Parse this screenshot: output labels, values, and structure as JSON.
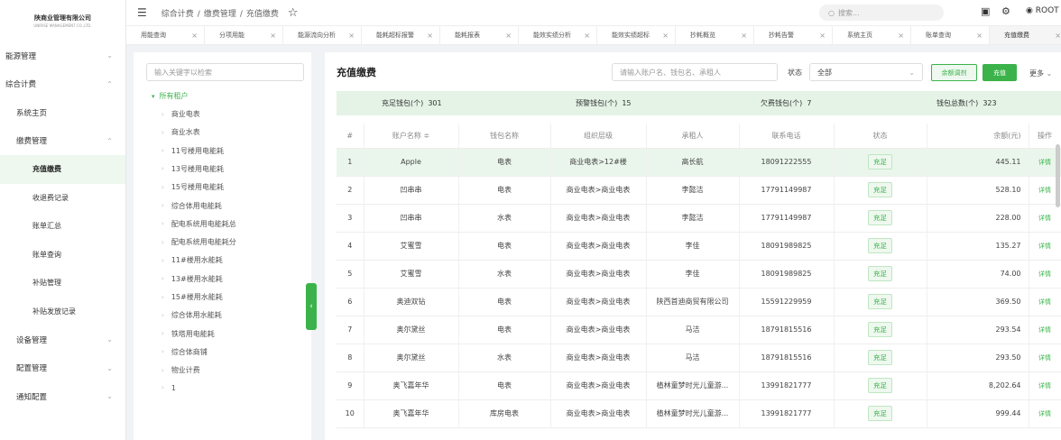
{
  "logo": {
    "name": "陕商业管理有限公司",
    "sub": "UNIRISE MANAGEMENT CO.,LTD."
  },
  "sidebar": {
    "items": [
      {
        "label": "能源管理",
        "level": 0,
        "chevron": "⌄"
      },
      {
        "label": "综合计费",
        "level": 0,
        "chevron": "⌃"
      },
      {
        "label": "系统主页",
        "level": 1,
        "chevron": ""
      },
      {
        "label": "缴费管理",
        "level": 1,
        "chevron": "⌃"
      },
      {
        "label": "充值缴费",
        "level": 2,
        "chevron": ""
      },
      {
        "label": "收退费记录",
        "level": 2,
        "chevron": ""
      },
      {
        "label": "账单汇总",
        "level": 2,
        "chevron": ""
      },
      {
        "label": "账单查询",
        "level": 2,
        "chevron": ""
      },
      {
        "label": "补贴管理",
        "level": 2,
        "chevron": ""
      },
      {
        "label": "补贴发放记录",
        "level": 2,
        "chevron": ""
      },
      {
        "label": "设备管理",
        "level": 1,
        "chevron": "⌄"
      },
      {
        "label": "配置管理",
        "level": 1,
        "chevron": "⌄"
      },
      {
        "label": "通知配置",
        "level": 1,
        "chevron": "⌄"
      }
    ]
  },
  "header": {
    "breadcrumb": [
      "综合计费",
      "缴费管理",
      "充值缴费"
    ],
    "search_placeholder": "搜索...",
    "user": "ROOT"
  },
  "tabs": [
    "用能查询",
    "分项用能",
    "能源流向分析",
    "能耗超标报警",
    "能耗报表",
    "能效实绩分析",
    "能效实绩超标",
    "抄耗概览",
    "抄耗告警",
    "系统主页",
    "账单查询",
    "充值缴费"
  ],
  "tree": {
    "search_placeholder": "输入关键字以检索",
    "root": "所有租户",
    "children": [
      "商业电表",
      "商业水表",
      "11号楼用电能耗",
      "13号楼用电能耗",
      "15号楼用电能耗",
      "综合体用电能耗",
      "配电系统用电能耗总",
      "配电系统用电能耗分",
      "11#楼用水能耗",
      "13#楼用水能耗",
      "15#楼用水能耗",
      "综合体用水能耗",
      "铁塔用电能耗",
      "综合体商铺",
      "物业计费",
      "1"
    ]
  },
  "main": {
    "title": "充值缴费",
    "acct_placeholder": "请输入账户名、钱包名、承租人",
    "status_label": "状态",
    "status_value": "全部",
    "btn_adjust": "余额调剂",
    "btn_charge": "充值",
    "more": "更多"
  },
  "summary": [
    {
      "label": "充足钱包(个)",
      "value": "301"
    },
    {
      "label": "预警钱包(个)",
      "value": "15"
    },
    {
      "label": "欠费钱包(个)",
      "value": "7"
    },
    {
      "label": "钱包总数(个)",
      "value": "323"
    }
  ],
  "table": {
    "headers": [
      "#",
      "账户名称 ≑",
      "钱包名称",
      "组织层级",
      "承租人",
      "联系电话",
      "状态",
      "余额(元)",
      "操作"
    ],
    "rows": [
      [
        "1",
        "Apple",
        "电表",
        "商业电表>12#楼",
        "高长航",
        "18091222555",
        "充足",
        "445.11",
        "详情"
      ],
      [
        "2",
        "凹串串",
        "电表",
        "商业电表>商业电表",
        "李懿洁",
        "17791149987",
        "充足",
        "528.10",
        "详情"
      ],
      [
        "3",
        "凹串串",
        "水表",
        "商业电表>商业电表",
        "李懿洁",
        "17791149987",
        "充足",
        "228.00",
        "详情"
      ],
      [
        "4",
        "艾蜜雪",
        "电表",
        "商业电表>商业电表",
        "李佳",
        "18091989825",
        "充足",
        "135.27",
        "详情"
      ],
      [
        "5",
        "艾蜜雪",
        "水表",
        "商业电表>商业电表",
        "李佳",
        "18091989825",
        "充足",
        "74.00",
        "详情"
      ],
      [
        "6",
        "奥迪双钻",
        "电表",
        "商业电表>商业电表",
        "陕西首迪商贸有限公司",
        "15591229959",
        "充足",
        "369.50",
        "详情"
      ],
      [
        "7",
        "奥尔黛丝",
        "电表",
        "商业电表>商业电表",
        "马洁",
        "18791815516",
        "充足",
        "293.54",
        "详情"
      ],
      [
        "8",
        "奥尔黛丝",
        "水表",
        "商业电表>商业电表",
        "马洁",
        "18791815516",
        "充足",
        "293.50",
        "详情"
      ],
      [
        "9",
        "奥飞嘉年华",
        "电表",
        "商业电表>商业电表",
        "植林童梦时光儿童游...",
        "13991821777",
        "充足",
        "8,202.64",
        "详情"
      ],
      [
        "10",
        "奥飞嘉年华",
        "库房电表",
        "商业电表>商业电表",
        "植林童梦时光儿童游...",
        "13991821777",
        "充足",
        "999.44",
        "详情"
      ]
    ]
  }
}
